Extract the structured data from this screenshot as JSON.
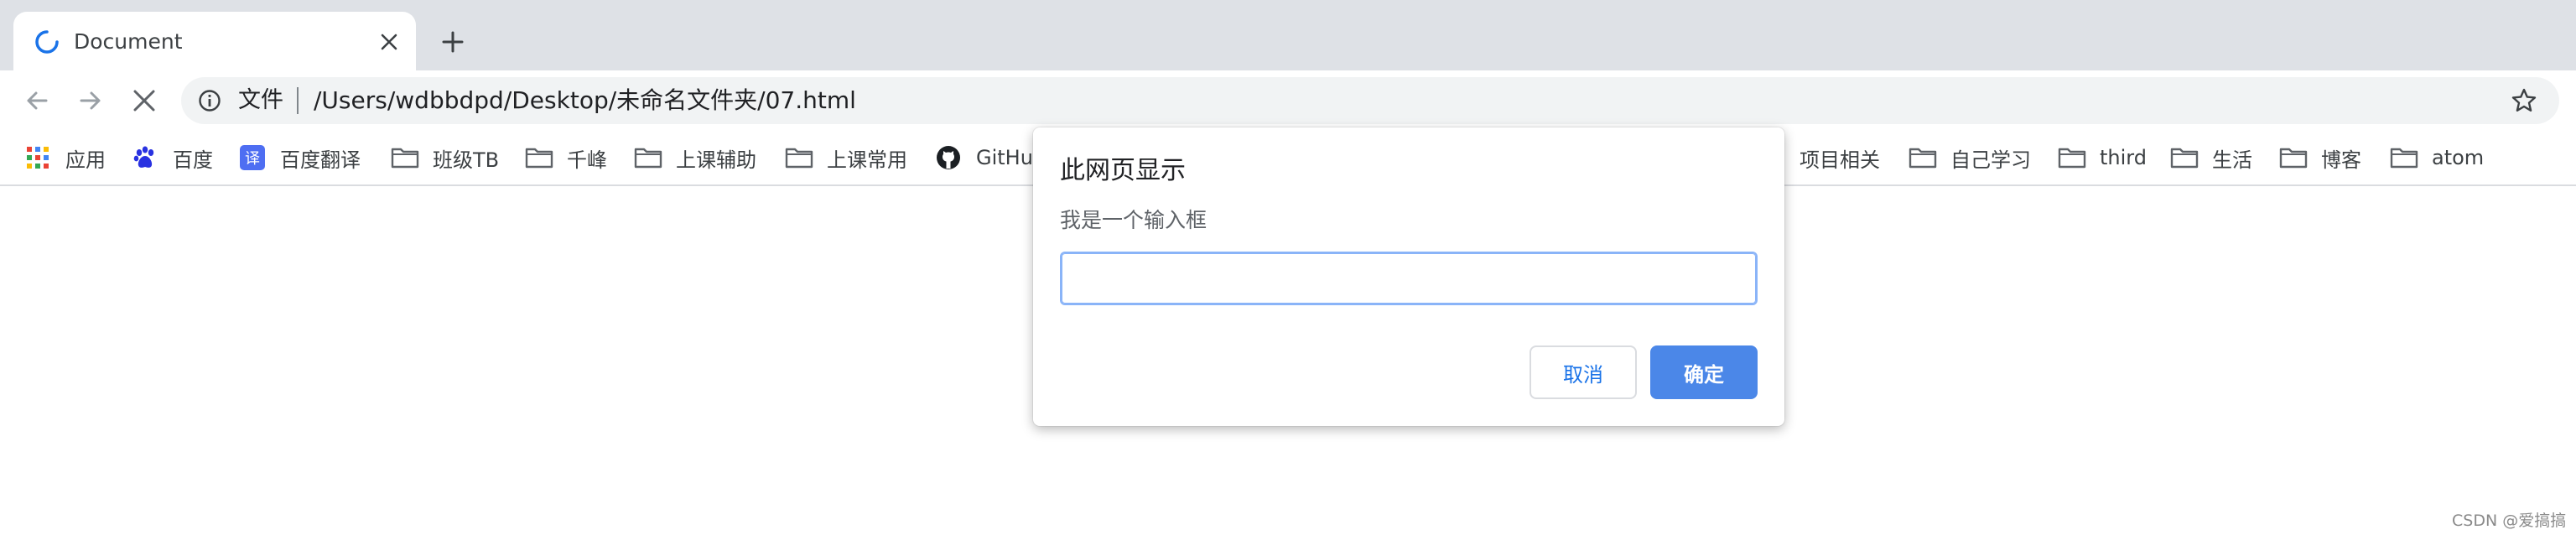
{
  "tab": {
    "title": "Document"
  },
  "toolbar": {
    "scheme_label": "文件",
    "url": "/Users/wdbbdpd/Desktop/未命名文件夹/07.html"
  },
  "bookmarks": [
    {
      "label": "应用",
      "icon": "apps-grid-icon"
    },
    {
      "label": "百度",
      "icon": "baidu-paw-icon"
    },
    {
      "label": "百度翻译",
      "icon": "baidu-translate-icon"
    },
    {
      "label": "班级TB",
      "icon": "folder-icon"
    },
    {
      "label": "千峰",
      "icon": "folder-icon"
    },
    {
      "label": "上课辅助",
      "icon": "folder-icon"
    },
    {
      "label": "上课常用",
      "icon": "folder-icon"
    },
    {
      "label": "GitHu",
      "icon": "github-icon"
    },
    {
      "label": "项目相关",
      "icon": "folder-icon"
    },
    {
      "label": "自己学习",
      "icon": "folder-icon"
    },
    {
      "label": "third",
      "icon": "folder-icon"
    },
    {
      "label": "生活",
      "icon": "folder-icon"
    },
    {
      "label": "博客",
      "icon": "folder-icon"
    },
    {
      "label": "atom",
      "icon": "folder-icon"
    }
  ],
  "dialog": {
    "title": "此网页显示",
    "message": "我是一个输入框",
    "input_value": "",
    "cancel_label": "取消",
    "ok_label": "确定"
  },
  "watermark": "CSDN @爱搞搞",
  "colors": {
    "tabstrip_bg": "#dee1e6",
    "omnibox_bg": "#f1f3f4",
    "accent_blue": "#4b87e8",
    "link_blue": "#1a73e8",
    "folder_gray": "#5f6368"
  }
}
